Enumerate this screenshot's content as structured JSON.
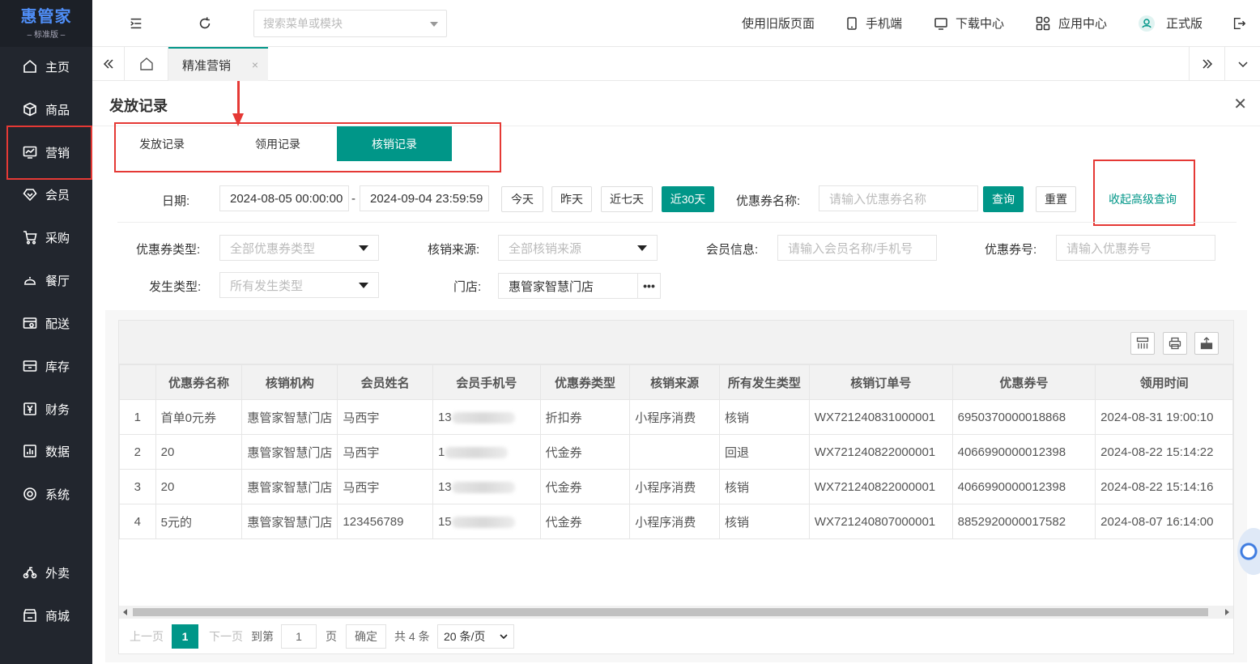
{
  "brand": {
    "title": "惠管家",
    "subtitle": "– 标准版 –"
  },
  "sidebar": {
    "items": [
      {
        "label": "主页",
        "icon": "home-icon"
      },
      {
        "label": "商品",
        "icon": "cube-icon"
      },
      {
        "label": "营销",
        "icon": "chart-monitor-icon"
      },
      {
        "label": "会员",
        "icon": "diamond-icon"
      },
      {
        "label": "采购",
        "icon": "cart-icon"
      },
      {
        "label": "餐厅",
        "icon": "cloche-icon"
      },
      {
        "label": "配送",
        "icon": "delivery-icon"
      },
      {
        "label": "库存",
        "icon": "box-icon"
      },
      {
        "label": "财务",
        "icon": "yen-icon"
      },
      {
        "label": "数据",
        "icon": "bar-chart-icon"
      },
      {
        "label": "系统",
        "icon": "target-icon"
      },
      {
        "label": "外卖",
        "icon": "bike-icon"
      },
      {
        "label": "商城",
        "icon": "shop-icon"
      }
    ]
  },
  "topbar": {
    "search_placeholder": "搜索菜单或模块",
    "links": [
      "使用旧版页面",
      "手机端",
      "下载中心",
      "应用中心",
      "正式版"
    ]
  },
  "tabs": {
    "current": "精准营销"
  },
  "page": {
    "title": "发放记录",
    "subtabs": [
      "发放记录",
      "领用记录",
      "核销记录"
    ],
    "active_subtab": "核销记录"
  },
  "filter": {
    "date_label": "日期:",
    "date_start": "2024-08-05 00:00:00",
    "date_sep": "-",
    "date_end": "2024-09-04 23:59:59",
    "quick": [
      "今天",
      "昨天",
      "近七天",
      "近30天"
    ],
    "coupon_name_label": "优惠券名称:",
    "coupon_name_placeholder": "请输入优惠券名称",
    "query": "查询",
    "reset": "重置",
    "collapse": "收起高级查询",
    "coupon_type_label": "优惠券类型:",
    "coupon_type_value": "全部优惠券类型",
    "source_label": "核销来源:",
    "source_value": "全部核销来源",
    "member_label": "会员信息:",
    "member_placeholder": "请输入会员名称/手机号",
    "coupon_no_label": "优惠券号:",
    "coupon_no_placeholder": "请输入优惠券号",
    "occur_type_label": "发生类型:",
    "occur_type_value": "所有发生类型",
    "store_label": "门店:",
    "store_value": "惠管家智慧门店",
    "store_more": "•••"
  },
  "table": {
    "columns": [
      "",
      "优惠券名称",
      "核销机构",
      "会员姓名",
      "会员手机号",
      "优惠券类型",
      "核销来源",
      "所有发生类型",
      "核销订单号",
      "优惠券号",
      "领用时间"
    ],
    "rows": [
      {
        "idx": "1",
        "name": "首单0元券",
        "org": "惠管家智慧门店",
        "member": "马西宇",
        "phone": "13",
        "type": "折扣券",
        "source": "小程序消费",
        "occur": "核销",
        "order": "WX721240831000001",
        "coupon": "6950370000018868",
        "time": "2024-08-31 19:00:10"
      },
      {
        "idx": "2",
        "name": "20",
        "org": "惠管家智慧门店",
        "member": "马西宇",
        "phone": "1",
        "type": "代金券",
        "source": "",
        "occur": "回退",
        "order": "WX721240822000001",
        "coupon": "4066990000012398",
        "time": "2024-08-22 15:14:22"
      },
      {
        "idx": "3",
        "name": "20",
        "org": "惠管家智慧门店",
        "member": "马西宇",
        "phone": "13",
        "type": "代金券",
        "source": "小程序消费",
        "occur": "核销",
        "order": "WX721240822000001",
        "coupon": "4066990000012398",
        "time": "2024-08-22 15:14:16"
      },
      {
        "idx": "4",
        "name": "5元的",
        "org": "惠管家智慧门店",
        "member": "123456789",
        "phone": "15",
        "type": "代金券",
        "source": "小程序消费",
        "occur": "核销",
        "order": "WX721240807000001",
        "coupon": "8852920000017582",
        "time": "2024-08-07 16:14:00"
      }
    ]
  },
  "pager": {
    "prev": "上一页",
    "page": "1",
    "next": "下一页",
    "goto": "到第",
    "goto_value": "1",
    "page_unit": "页",
    "confirm": "确定",
    "total": "共 4 条",
    "size": "20 条/页"
  },
  "colors": {
    "accent": "#009688",
    "sidebar": "#22262e",
    "highlight": "#e53935",
    "logo": "#4f8ef7"
  }
}
